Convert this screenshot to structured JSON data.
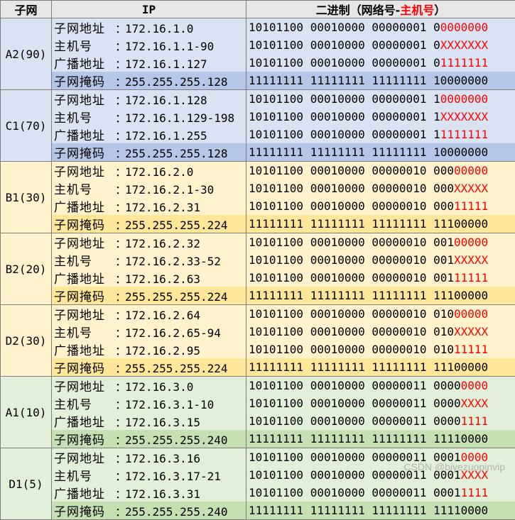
{
  "header": {
    "subnet": "子网",
    "ip": "IP",
    "binary_prefix": "二进制（网络号-",
    "binary_host": "主机号",
    "binary_suffix": "）"
  },
  "labels": {
    "subnet_addr": "子网地址",
    "host": "主机号",
    "broadcast": "广播地址",
    "mask": "子网掩码",
    "sep": "："
  },
  "colors": {
    "blue": "#dae3f3",
    "blue_mask": "#b4c7e7",
    "yellow": "#fff2cc",
    "yellow_mask": "#ffe699",
    "green": "#e2efd9",
    "green_mask": "#c5e0b3",
    "host_red": "#ff0000"
  },
  "groups": [
    {
      "name": "A2(90)",
      "color": "blue",
      "rows": [
        {
          "key": "subnet_addr",
          "ip": "172.16.1.0",
          "net": "10101100 00010000 00000001 0",
          "host": "0000000"
        },
        {
          "key": "host",
          "ip": "172.16.1.1-90",
          "net": "10101100 00010000 00000001 0",
          "host": "XXXXXXX"
        },
        {
          "key": "broadcast",
          "ip": "172.16.1.127",
          "net": "10101100 00010000 00000001 0",
          "host": "1111111"
        },
        {
          "key": "mask",
          "ip": "255.255.255.128",
          "net": "11111111 11111111 11111111 10000000",
          "host": ""
        }
      ]
    },
    {
      "name": "C1(70)",
      "color": "blue",
      "rows": [
        {
          "key": "subnet_addr",
          "ip": "172.16.1.128",
          "net": "10101100 00010000 00000001 1",
          "host": "0000000"
        },
        {
          "key": "host",
          "ip": "172.16.1.129-198",
          "net": "10101100 00010000 00000001 1",
          "host": "XXXXXXX"
        },
        {
          "key": "broadcast",
          "ip": "172.16.1.255",
          "net": "10101100 00010000 00000001 1",
          "host": "1111111"
        },
        {
          "key": "mask",
          "ip": "255.255.255.128",
          "net": "11111111 11111111 11111111 10000000",
          "host": ""
        }
      ]
    },
    {
      "name": "B1(30)",
      "color": "yellow",
      "rows": [
        {
          "key": "subnet_addr",
          "ip": "172.16.2.0",
          "net": "10101100 00010000 00000010 000",
          "host": "00000"
        },
        {
          "key": "host",
          "ip": "172.16.2.1-30",
          "net": "10101100 00010000 00000010 000",
          "host": "XXXXX"
        },
        {
          "key": "broadcast",
          "ip": "172.16.2.31",
          "net": "10101100 00010000 00000010 000",
          "host": "11111"
        },
        {
          "key": "mask",
          "ip": "255.255.255.224",
          "net": "11111111 11111111 11111111 11100000",
          "host": ""
        }
      ]
    },
    {
      "name": "B2(20)",
      "color": "yellow",
      "rows": [
        {
          "key": "subnet_addr",
          "ip": "172.16.2.32",
          "net": "10101100 00010000 00000010 001",
          "host": "00000"
        },
        {
          "key": "host",
          "ip": "172.16.2.33-52",
          "net": "10101100 00010000 00000010 001",
          "host": "XXXXX"
        },
        {
          "key": "broadcast",
          "ip": "172.16.2.63",
          "net": "10101100 00010000 00000010 001",
          "host": "11111"
        },
        {
          "key": "mask",
          "ip": "255.255.255.224",
          "net": "11111111 11111111 11111111 11100000",
          "host": ""
        }
      ]
    },
    {
      "name": "D2(30)",
      "color": "yellow",
      "rows": [
        {
          "key": "subnet_addr",
          "ip": "172.16.2.64",
          "net": "10101100 00010000 00000010 010",
          "host": "00000"
        },
        {
          "key": "host",
          "ip": "172.16.2.65-94",
          "net": "10101100 00010000 00000010 010",
          "host": "XXXXX"
        },
        {
          "key": "broadcast",
          "ip": "172.16.2.95",
          "net": "10101100 00010000 00000010 010",
          "host": "11111"
        },
        {
          "key": "mask",
          "ip": "255.255.255.224",
          "net": "11111111 11111111 11111111 11100000",
          "host": ""
        }
      ]
    },
    {
      "name": "A1(10)",
      "color": "green",
      "rows": [
        {
          "key": "subnet_addr",
          "ip": "172.16.3.0",
          "net": "10101100 00010000 00000011 0000",
          "host": "0000"
        },
        {
          "key": "host",
          "ip": "172.16.3.1-10",
          "net": "10101100 00010000 00000011 0000",
          "host": "XXXX"
        },
        {
          "key": "broadcast",
          "ip": "172.16.3.15",
          "net": "10101100 00010000 00000011 0000",
          "host": "1111"
        },
        {
          "key": "mask",
          "ip": "255.255.255.240",
          "net": "11111111 11111111 11111111 11110000",
          "host": ""
        }
      ]
    },
    {
      "name": "D1(5)",
      "color": "green",
      "rows": [
        {
          "key": "subnet_addr",
          "ip": "172.16.3.16",
          "net": "10101100 00010000 00000011 0001",
          "host": "0000"
        },
        {
          "key": "host",
          "ip": "172.16.3.17-21",
          "net": "10101100 00010000 00000011 0001",
          "host": "XXXX"
        },
        {
          "key": "broadcast",
          "ip": "172.16.3.31",
          "net": "10101100 00010000 00000011 0001",
          "host": "1111"
        },
        {
          "key": "mask",
          "ip": "255.255.255.240",
          "net": "11111111 11111111 11111111 11110000",
          "host": ""
        }
      ]
    }
  ],
  "watermark": "CSDN @biyezuopinvip"
}
